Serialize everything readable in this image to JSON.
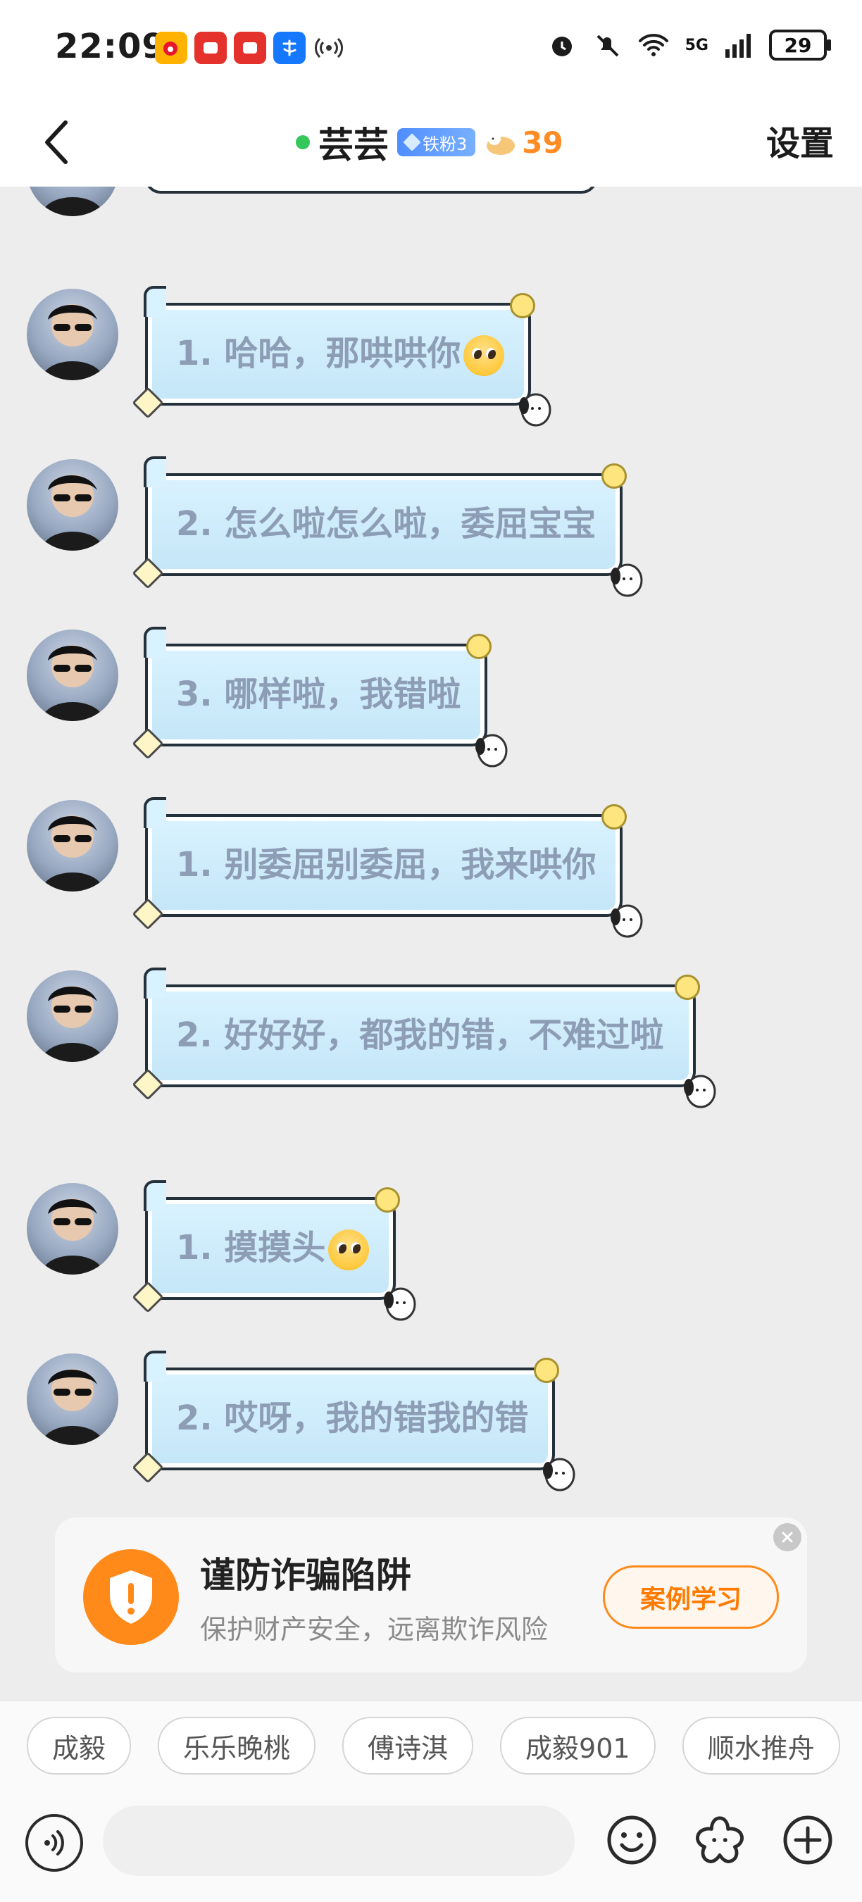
{
  "status_bar": {
    "time": "22:09",
    "network": "5G",
    "battery": "29"
  },
  "header": {
    "title": "芸芸",
    "fan_badge": "铁粉3",
    "level": "39",
    "settings": "设置"
  },
  "messages": [
    {
      "text": "1. 哈哈，那哄哄你"
    },
    {
      "text": "2. 怎么啦怎么啦，委屈宝宝"
    },
    {
      "text": "3. 哪样啦，我错啦"
    },
    {
      "text": "1. 别委屈别委屈，我来哄你"
    },
    {
      "text": "2. 好好好，都我的错，不难过啦"
    },
    {
      "text": "1. 摸摸头"
    },
    {
      "text": "2. 哎呀，我的错我的错"
    }
  ],
  "fraud_banner": {
    "title": "谨防诈骗陷阱",
    "subtitle": "保护财产安全，远离欺诈风险",
    "button": "案例学习"
  },
  "quick_replies": [
    "成毅",
    "乐乐晚桃",
    "傅诗淇",
    "成毅901",
    "顺水推舟"
  ],
  "input": {
    "placeholder": ""
  },
  "colors": {
    "accent": "#ff8a1a",
    "online": "#35c759",
    "bubble_text": "#8d9db5",
    "chat_bg": "#ededed"
  }
}
